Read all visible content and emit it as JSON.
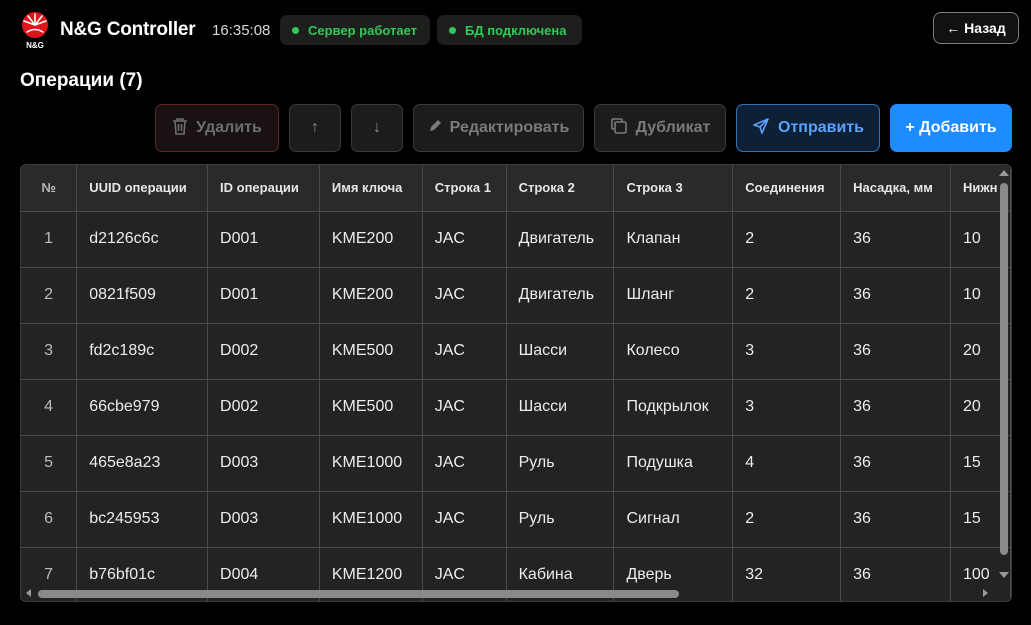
{
  "header": {
    "logo_text": "N&G",
    "app_title": "N&G Controller",
    "clock": "16:35:08",
    "server_status": "Сервер работает",
    "db_status": "БД подключена",
    "back_label": "← Назад",
    "status_color": "#34c759"
  },
  "page": {
    "title": "Операции (7)"
  },
  "toolbar": {
    "delete_label": "Удалить",
    "up_label": "↑",
    "down_label": "↓",
    "edit_label": "Редактировать",
    "duplicate_label": "Дубликат",
    "send_label": "Отправить",
    "add_label": "+ Добавить",
    "icons": {
      "delete": "trash-icon",
      "edit": "pencil-icon",
      "duplicate": "copy-icon",
      "send": "send-icon"
    },
    "colors": {
      "add": "#1e8cff",
      "send": "#5aa2ff"
    }
  },
  "table": {
    "columns": [
      "№",
      "UUID операции",
      "ID операции",
      "Имя ключа",
      "Строка 1",
      "Строка 2",
      "Строка 3",
      "Соединения",
      "Насадка, мм",
      "Нижн"
    ],
    "rows": [
      [
        "1",
        "d2126c6c",
        "D001",
        "KME200",
        "JAC",
        "Двигатель",
        "Клапан",
        "2",
        "36",
        "10"
      ],
      [
        "2",
        "0821f509",
        "D001",
        "KME200",
        "JAC",
        "Двигатель",
        "Шланг",
        "2",
        "36",
        "10"
      ],
      [
        "3",
        "fd2c189c",
        "D002",
        "KME500",
        "JAC",
        "Шасси",
        "Колесо",
        "3",
        "36",
        "20"
      ],
      [
        "4",
        "66cbe979",
        "D002",
        "KME500",
        "JAC",
        "Шасси",
        "Подкрылок",
        "3",
        "36",
        "20"
      ],
      [
        "5",
        "465e8a23",
        "D003",
        "KME1000",
        "JAC",
        "Руль",
        "Подушка",
        "4",
        "36",
        "15"
      ],
      [
        "6",
        "bc245953",
        "D003",
        "KME1000",
        "JAC",
        "Руль",
        "Сигнал",
        "2",
        "36",
        "15"
      ],
      [
        "7",
        "b76bf01c",
        "D004",
        "KME1200",
        "JAC",
        "Кабина",
        "Дверь",
        "32",
        "36",
        "100"
      ]
    ]
  }
}
